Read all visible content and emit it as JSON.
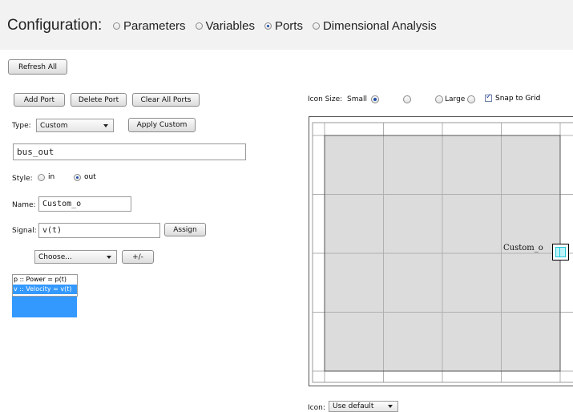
{
  "header": {
    "title": "Configuration:",
    "tabs": [
      {
        "label": "Parameters",
        "selected": false
      },
      {
        "label": "Variables",
        "selected": false
      },
      {
        "label": "Ports",
        "selected": true
      },
      {
        "label": "Dimensional Analysis",
        "selected": false
      }
    ]
  },
  "toolbar": {
    "refresh_all": "Refresh All",
    "add_port": "Add Port",
    "delete_port": "Delete Port",
    "clear_all_ports": "Clear All Ports"
  },
  "type_row": {
    "label": "Type:",
    "value": "Custom",
    "apply_custom": "Apply Custom"
  },
  "port_type_field": "bus_out",
  "style_row": {
    "label": "Style:",
    "options": [
      {
        "label": "in",
        "selected": false
      },
      {
        "label": "out",
        "selected": true
      }
    ]
  },
  "name_row": {
    "label": "Name:",
    "value": "Custom_o"
  },
  "signal_row": {
    "label": "Signal:",
    "value": "v(t)",
    "assign": "Assign"
  },
  "choose_row": {
    "value": "Choose...",
    "plus_minus": "+/-"
  },
  "signals_list": [
    {
      "text": "p :: Power = p(t)",
      "selected": false
    },
    {
      "text": "v :: Velocity = v(t)",
      "selected": true
    }
  ],
  "icon_size": {
    "label": "Icon Size:",
    "small": "Small",
    "large": "Large",
    "selected_index": 0,
    "snap_label": "Snap to Grid",
    "snap_checked": true
  },
  "canvas": {
    "port_label": "Custom_o"
  },
  "icon_row": {
    "label": "Icon:",
    "value": "Use default"
  },
  "colors": {
    "header_bg": "#f2f2f2",
    "canvas_area": "#dcdcdc",
    "grid_line": "#b0b0b0",
    "list_selection": "#3399ff",
    "port_accent": "#20c8d8"
  }
}
